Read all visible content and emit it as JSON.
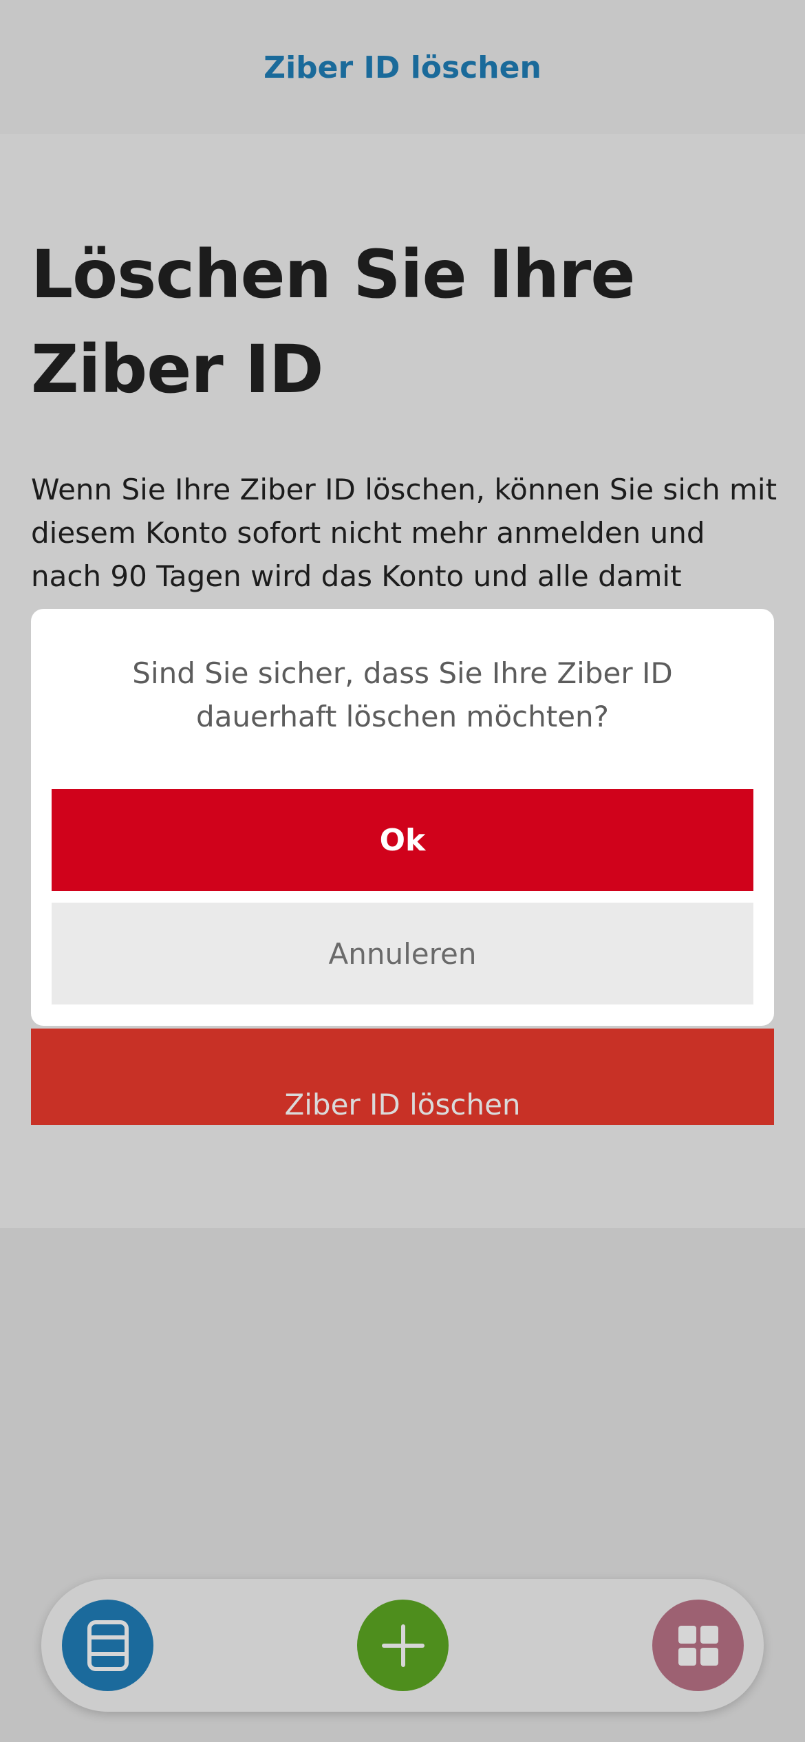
{
  "header": {
    "title": "Ziber ID löschen"
  },
  "main": {
    "heading": "Löschen Sie Ihre Ziber ID",
    "body": "Wenn Sie Ihre Ziber ID löschen, können Sie sich mit diesem Konto sofort nicht mehr anmelden und nach 90 Tagen wird das Konto und alle damit",
    "delete_button_label": "Ziber ID löschen"
  },
  "dialog": {
    "message": "Sind Sie sicher, dass Sie Ihre Ziber ID dauerhaft löschen möchten?",
    "ok_label": "Ok",
    "cancel_label": "Annuleren"
  },
  "bottom_nav": {
    "items": [
      {
        "icon": "list-icon",
        "color": "#1b6a9c"
      },
      {
        "icon": "plus-icon",
        "color": "#4e8e1d"
      },
      {
        "icon": "grid-icon",
        "color": "#9d6172"
      }
    ]
  },
  "colors": {
    "accent_blue": "#1a6a9a",
    "ok_red": "#d0021b",
    "delete_red": "#c83126"
  }
}
